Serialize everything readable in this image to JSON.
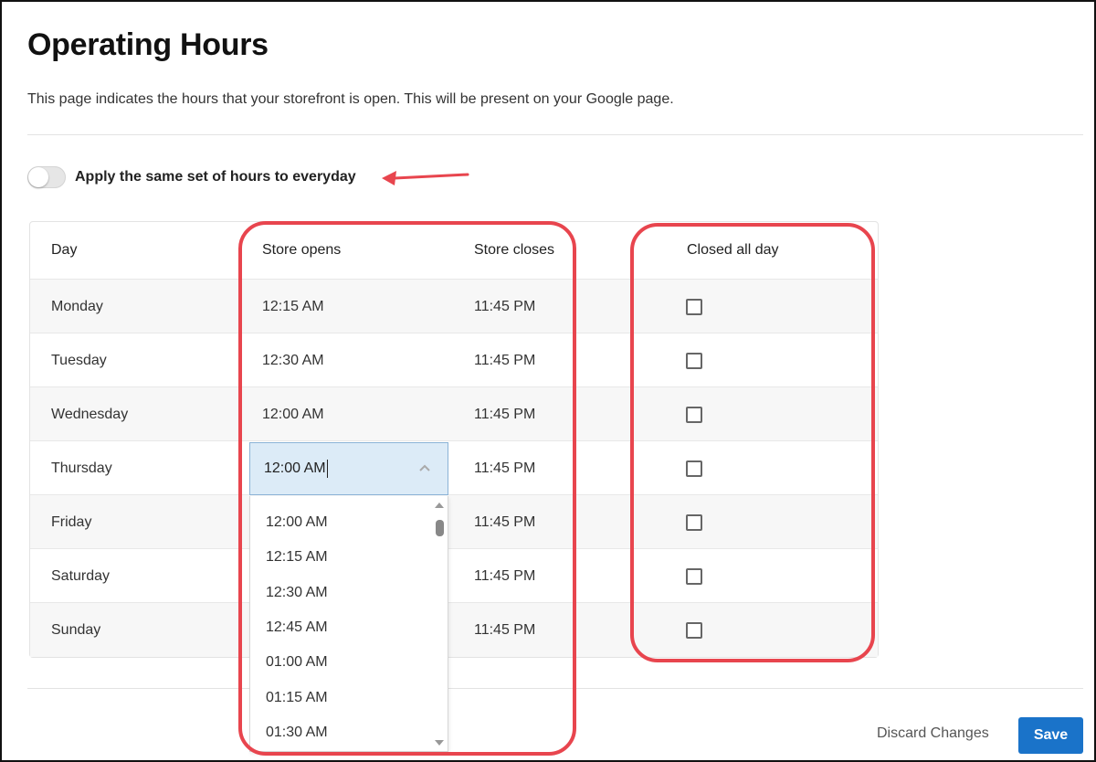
{
  "page": {
    "title": "Operating Hours",
    "description": "This page indicates the hours that your storefront is open. This will be present on your Google page."
  },
  "toggle": {
    "label": "Apply the same set of hours to everyday",
    "on": false
  },
  "table": {
    "headers": {
      "day": "Day",
      "opens": "Store opens",
      "closes": "Store closes",
      "closed": "Closed all day"
    },
    "rows": [
      {
        "day": "Monday",
        "opens": "12:15 AM",
        "closes": "11:45 PM",
        "closed": false
      },
      {
        "day": "Tuesday",
        "opens": "12:30 AM",
        "closes": "11:45 PM",
        "closed": false
      },
      {
        "day": "Wednesday",
        "opens": "12:00 AM",
        "closes": "11:45 PM",
        "closed": false
      },
      {
        "day": "Thursday",
        "opens": "12:00 AM",
        "closes": "11:45 PM",
        "closed": false
      },
      {
        "day": "Friday",
        "opens": "",
        "closes": "11:45 PM",
        "closed": false
      },
      {
        "day": "Saturday",
        "opens": "",
        "closes": "11:45 PM",
        "closed": false
      },
      {
        "day": "Sunday",
        "opens": "",
        "closes": "11:45 PM",
        "closed": false
      }
    ]
  },
  "dropdown": {
    "selected": "12:00 AM",
    "options": [
      "12:00 AM",
      "12:15 AM",
      "12:30 AM",
      "12:45 AM",
      "01:00 AM",
      "01:15 AM",
      "01:30 AM"
    ]
  },
  "footer": {
    "discard_label": "Discard Changes",
    "save_label": "Save"
  },
  "colors": {
    "accent": "#1a73c9",
    "annotation": "#e8454e",
    "select_bg": "#dcebf7"
  }
}
